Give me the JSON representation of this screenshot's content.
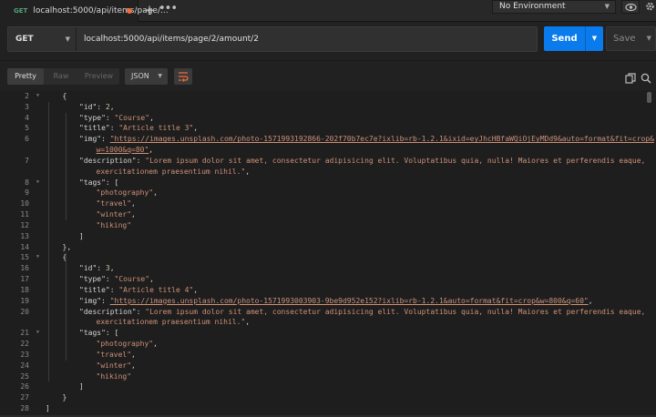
{
  "tab": {
    "method": "GET",
    "title": "localhost:5000/api/items/page/..."
  },
  "env": {
    "label": "No Environment"
  },
  "request": {
    "method": "GET",
    "url": "localhost:5000/api/items/page/2/amount/2",
    "send": "Send",
    "save": "Save"
  },
  "response": {
    "modes": [
      "Pretty",
      "Raw",
      "Preview"
    ],
    "format": "JSON"
  },
  "lines": [
    {
      "n": "2",
      "i": 1,
      "t": [
        [
          "p",
          "{"
        ]
      ],
      "f": true
    },
    {
      "n": "3",
      "i": 2,
      "t": [
        [
          "k",
          "\"id\": "
        ],
        [
          "n",
          "2"
        ],
        [
          "p",
          ","
        ]
      ]
    },
    {
      "n": "4",
      "i": 2,
      "t": [
        [
          "k",
          "\"type\": "
        ],
        [
          "s",
          "\"Course\""
        ],
        [
          "p",
          ","
        ]
      ]
    },
    {
      "n": "5",
      "i": 2,
      "t": [
        [
          "k",
          "\"title\": "
        ],
        [
          "s",
          "\"Article title 3\""
        ],
        [
          "p",
          ","
        ]
      ]
    },
    {
      "n": "6",
      "i": 2,
      "t": [
        [
          "k",
          "\"img\": "
        ],
        [
          "u",
          "\"https://images.unsplash.com/photo-1571993192866-202f70b7ec7e?ixlib=rb-1.2.1&ixid=eyJhcHBfaWQiOjEyMDd9&auto=format&fit=crop&"
        ]
      ]
    },
    {
      "n": "",
      "i": 3,
      "t": [
        [
          "u",
          "w=1000&q=80\""
        ],
        [
          "p",
          ","
        ]
      ]
    },
    {
      "n": "7",
      "i": 2,
      "t": [
        [
          "k",
          "\"description\": "
        ],
        [
          "s",
          "\"Lorem ipsum dolor sit amet, consectetur adipisicing elit. Voluptatibus quia, nulla! Maiores et perferendis eaque,"
        ]
      ]
    },
    {
      "n": "",
      "i": 3,
      "t": [
        [
          "s",
          "exercitationem praesentium nihil.\""
        ],
        [
          "p",
          ","
        ]
      ]
    },
    {
      "n": "8",
      "i": 2,
      "t": [
        [
          "k",
          "\"tags\": "
        ],
        [
          "p",
          "["
        ]
      ],
      "f": true
    },
    {
      "n": "9",
      "i": 3,
      "t": [
        [
          "s",
          "\"photography\""
        ],
        [
          "p",
          ","
        ]
      ]
    },
    {
      "n": "10",
      "i": 3,
      "t": [
        [
          "s",
          "\"travel\""
        ],
        [
          "p",
          ","
        ]
      ]
    },
    {
      "n": "11",
      "i": 3,
      "t": [
        [
          "s",
          "\"winter\""
        ],
        [
          "p",
          ","
        ]
      ]
    },
    {
      "n": "12",
      "i": 3,
      "t": [
        [
          "s",
          "\"hiking\""
        ]
      ]
    },
    {
      "n": "13",
      "i": 2,
      "t": [
        [
          "p",
          "]"
        ]
      ]
    },
    {
      "n": "14",
      "i": 1,
      "t": [
        [
          "p",
          "},"
        ]
      ]
    },
    {
      "n": "15",
      "i": 1,
      "t": [
        [
          "p",
          "{"
        ]
      ],
      "f": true
    },
    {
      "n": "16",
      "i": 2,
      "t": [
        [
          "k",
          "\"id\": "
        ],
        [
          "n",
          "3"
        ],
        [
          "p",
          ","
        ]
      ]
    },
    {
      "n": "17",
      "i": 2,
      "t": [
        [
          "k",
          "\"type\": "
        ],
        [
          "s",
          "\"Course\""
        ],
        [
          "p",
          ","
        ]
      ]
    },
    {
      "n": "18",
      "i": 2,
      "t": [
        [
          "k",
          "\"title\": "
        ],
        [
          "s",
          "\"Article title 4\""
        ],
        [
          "p",
          ","
        ]
      ]
    },
    {
      "n": "19",
      "i": 2,
      "t": [
        [
          "k",
          "\"img\": "
        ],
        [
          "u",
          "\"https://images.unsplash.com/photo-1571993003903-9be9d952e152?ixlib=rb-1.2.1&auto=format&fit=crop&w=800&q=60\""
        ],
        [
          "p",
          ","
        ]
      ]
    },
    {
      "n": "20",
      "i": 2,
      "t": [
        [
          "k",
          "\"description\": "
        ],
        [
          "s",
          "\"Lorem ipsum dolor sit amet, consectetur adipisicing elit. Voluptatibus quia, nulla! Maiores et perferendis eaque,"
        ]
      ]
    },
    {
      "n": "",
      "i": 3,
      "t": [
        [
          "s",
          "exercitationem praesentium nihil.\""
        ],
        [
          "p",
          ","
        ]
      ]
    },
    {
      "n": "21",
      "i": 2,
      "t": [
        [
          "k",
          "\"tags\": "
        ],
        [
          "p",
          "["
        ]
      ],
      "f": true
    },
    {
      "n": "22",
      "i": 3,
      "t": [
        [
          "s",
          "\"photography\""
        ],
        [
          "p",
          ","
        ]
      ]
    },
    {
      "n": "23",
      "i": 3,
      "t": [
        [
          "s",
          "\"travel\""
        ],
        [
          "p",
          ","
        ]
      ]
    },
    {
      "n": "24",
      "i": 3,
      "t": [
        [
          "s",
          "\"winter\""
        ],
        [
          "p",
          ","
        ]
      ]
    },
    {
      "n": "25",
      "i": 3,
      "t": [
        [
          "s",
          "\"hiking\""
        ]
      ]
    },
    {
      "n": "26",
      "i": 2,
      "t": [
        [
          "p",
          "]"
        ]
      ]
    },
    {
      "n": "27",
      "i": 1,
      "t": [
        [
          "p",
          "}"
        ]
      ]
    },
    {
      "n": "28",
      "i": 0,
      "t": [
        [
          "p",
          "]"
        ]
      ]
    }
  ]
}
